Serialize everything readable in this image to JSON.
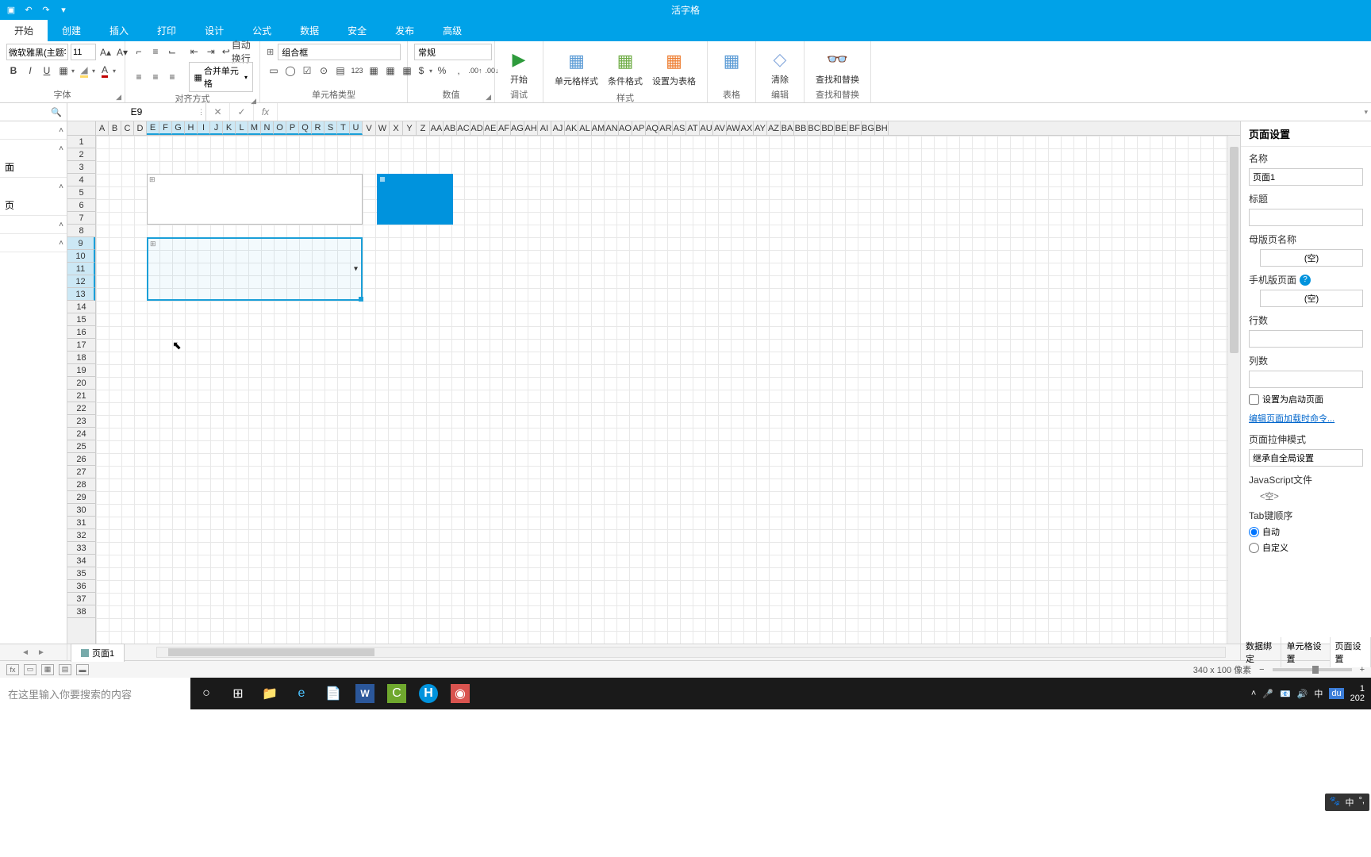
{
  "app": {
    "title": "活字格"
  },
  "qat": {
    "undo_icon": "↶",
    "redo_icon": "↷",
    "dd_icon": "▾"
  },
  "tabs": [
    "开始",
    "创建",
    "插入",
    "打印",
    "设计",
    "公式",
    "数据",
    "安全",
    "发布",
    "高级"
  ],
  "ribbon": {
    "font": {
      "group_label": "字体",
      "family": "微软雅黑(主题字",
      "size": "11",
      "grow": "A▴",
      "shrink": "A▾",
      "bold": "B",
      "italic": "I",
      "underline": "U",
      "border_icon": "▦",
      "fill_icon": "◢",
      "fill_color": "#ffd966",
      "font_color_icon": "A",
      "font_color": "#c00000"
    },
    "align": {
      "group_label": "对齐方式",
      "top": "⌐",
      "mid": "≡",
      "bot": "⌙",
      "outdent": "⇤",
      "indent": "⇥",
      "left": "≡",
      "center": "≡",
      "right": "≡",
      "wrap_icon": "↩",
      "wrap_label": "自动换行",
      "merge_icon": "▦",
      "merge_label": "合并单元格"
    },
    "celltype": {
      "group_label": "单元格类型",
      "value": "组合框",
      "btns": [
        "▭",
        "◯",
        "☑",
        "⊙",
        "▤",
        "123",
        "▦",
        "▦",
        "▦"
      ]
    },
    "number": {
      "group_label": "数值",
      "value": "常规",
      "currency": "$",
      "percent": "%",
      "comma": ",",
      "inc": ".00↑",
      "dec": ".00↓"
    },
    "debug": {
      "group_label": "调试",
      "run_color": "#2e9b3c",
      "run_label": "开始"
    },
    "styles": {
      "group_label": "样式",
      "cell_style": "单元格样式",
      "cond_fmt": "条件格式",
      "as_table": "设置为表格"
    },
    "table": {
      "group_label": "表格",
      "icon": "▦"
    },
    "edit": {
      "group_label": "编辑",
      "clear": "清除",
      "clear_icon": "◇"
    },
    "find": {
      "group_label": "查找和替换",
      "label": "查找和替换",
      "icon": "🔍"
    }
  },
  "formula_bar": {
    "search_icon": "🔍",
    "cell_ref": "E9",
    "cancel": "✕",
    "confirm": "✓",
    "fx": "fx"
  },
  "left_panel": {
    "collapse_icon": "˄",
    "sections": [
      {
        "items": [
          "面"
        ]
      },
      {
        "items": [
          "页"
        ]
      },
      {
        "items": []
      },
      {
        "items": []
      }
    ]
  },
  "grid": {
    "cols_narrow": [
      "A",
      "B",
      "C",
      "D"
    ],
    "cols_sel": [
      "E",
      "F",
      "G",
      "H",
      "I",
      "J",
      "K",
      "L",
      "M",
      "N",
      "O",
      "P",
      "Q",
      "R",
      "S",
      "T",
      "U"
    ],
    "cols_rest": [
      "V",
      "W",
      "X",
      "Y",
      "Z",
      "AA",
      "AB",
      "AC",
      "AD",
      "AE",
      "AF",
      "AG",
      "AH",
      "AI",
      "AJ",
      "AK",
      "AL",
      "AM",
      "AN",
      "AO",
      "AP",
      "AQ",
      "AR",
      "AS",
      "AT",
      "AU",
      "AV",
      "AW",
      "AX",
      "AY",
      "AZ",
      "BA",
      "BB",
      "BC",
      "BD",
      "BE",
      "BF",
      "BG",
      "BH"
    ],
    "row_count": 38,
    "selected_rows": [
      9,
      10,
      11,
      12,
      13
    ]
  },
  "right_panel": {
    "title": "页面设置",
    "name_label": "名称",
    "name_value": "页面1",
    "title_label": "标题",
    "title_value": "",
    "master_label": "母版页名称",
    "master_value": "(空)",
    "mobile_label": "手机版页面",
    "mobile_value": "(空)",
    "rows_label": "行数",
    "rows_value": "",
    "cols_label": "列数",
    "cols_value": "",
    "startup_label": "设置为启动页面",
    "edit_load_cmd": "编辑页面加载时命令...",
    "stretch_label": "页面拉伸模式",
    "stretch_value": "继承自全局设置",
    "js_label": "JavaScript文件",
    "js_value": "<空>",
    "tab_label": "Tab键顺序",
    "tab_auto": "自动",
    "tab_custom": "自定义"
  },
  "sheet": {
    "tab_label": "页面1",
    "nav_left": "◄",
    "nav_right": "►"
  },
  "bottom_tabs": [
    "数据绑定",
    "单元格设置",
    "页面设置"
  ],
  "status": {
    "dims": "340 x 100 像素",
    "minus": "−",
    "plus": "+"
  },
  "taskbar": {
    "search_placeholder": "在这里输入你要搜索的内容",
    "cortana": "○",
    "tasks": "⊞",
    "tray_icons": [
      "˄",
      "🎤",
      "📧",
      "🔊",
      "中"
    ],
    "du_badge": "du",
    "clock_time": "1",
    "clock_date": "202"
  },
  "ime": {
    "paw": "🐾",
    "lang": "中",
    "punct": "°,"
  }
}
